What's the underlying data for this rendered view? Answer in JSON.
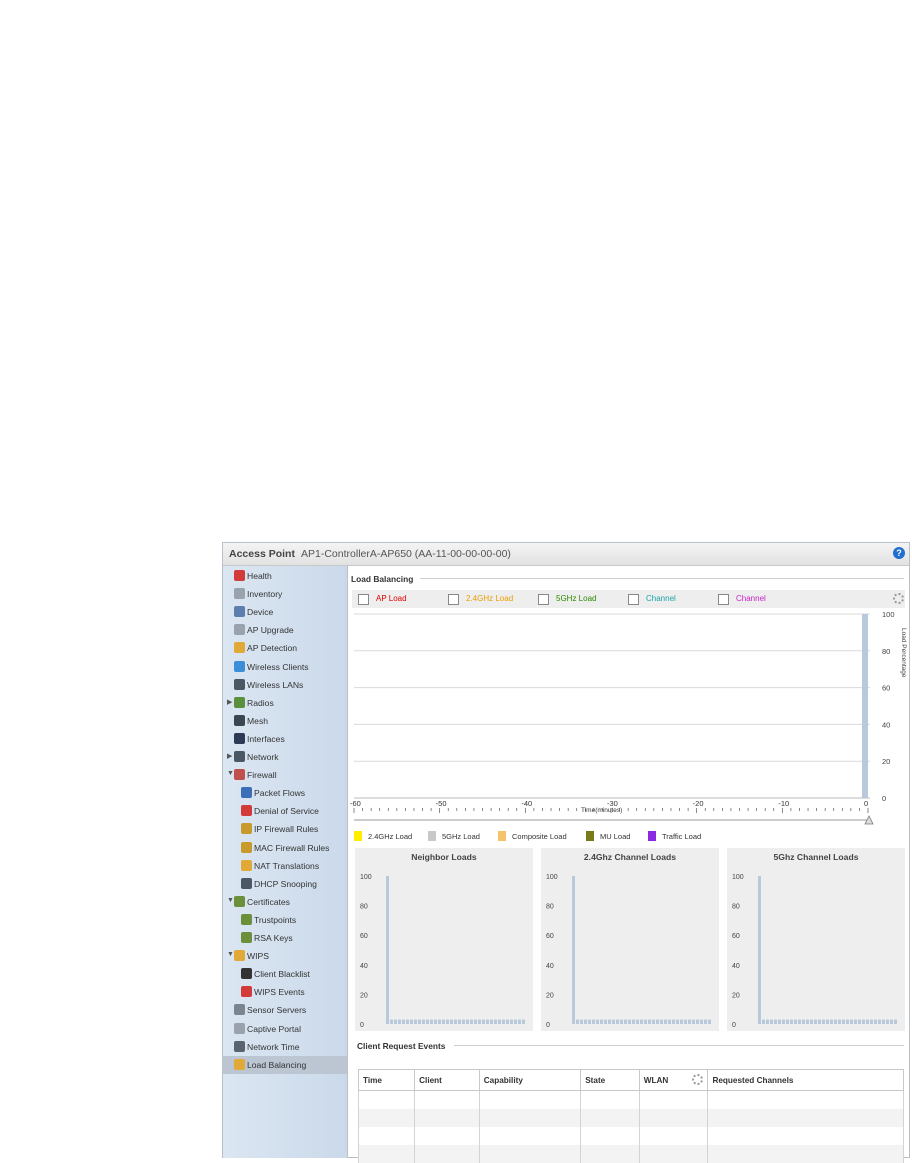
{
  "header": {
    "title": "Access Point",
    "device": "AP1-ControllerA-AP650 (AA-11-00-00-00-00)",
    "help_label": "?"
  },
  "sidebar": {
    "items": [
      {
        "label": "Health",
        "icon": "health-icon",
        "color": "#d33b3b",
        "indent": 0
      },
      {
        "label": "Inventory",
        "icon": "inventory-icon",
        "color": "#9aa3ad",
        "indent": 0
      },
      {
        "label": "Device",
        "icon": "device-icon",
        "color": "#5d7fb0",
        "indent": 0
      },
      {
        "label": "AP Upgrade",
        "icon": "ap-upgrade-icon",
        "color": "#9aa3ad",
        "indent": 0
      },
      {
        "label": "AP Detection",
        "icon": "ap-detection-icon",
        "color": "#e0a938",
        "indent": 0
      },
      {
        "label": "Wireless Clients",
        "icon": "wireless-clients-icon",
        "color": "#3d8ed8",
        "indent": 0
      },
      {
        "label": "Wireless LANs",
        "icon": "wireless-lans-icon",
        "color": "#4a5866",
        "indent": 0
      },
      {
        "label": "Radios",
        "icon": "radios-icon",
        "color": "#5a8f3d",
        "indent": 0,
        "arrow": "▶"
      },
      {
        "label": "Mesh",
        "icon": "mesh-icon",
        "color": "#3a4652",
        "indent": 0
      },
      {
        "label": "Interfaces",
        "icon": "interfaces-icon",
        "color": "#2d3a55",
        "indent": 0
      },
      {
        "label": "Network",
        "icon": "network-icon",
        "color": "#4a5866",
        "indent": 0,
        "arrow": "▶"
      },
      {
        "label": "Firewall",
        "icon": "firewall-icon",
        "color": "#c0504d",
        "indent": 0,
        "arrow": "▼"
      },
      {
        "label": "Packet Flows",
        "icon": "packet-flows-icon",
        "color": "#3d6fb8",
        "indent": 1
      },
      {
        "label": "Denial of Service",
        "icon": "denial-of-service-icon",
        "color": "#d33b3b",
        "indent": 1
      },
      {
        "label": "IP Firewall Rules",
        "icon": "ip-firewall-rules-icon",
        "color": "#c79a2b",
        "indent": 1
      },
      {
        "label": "MAC Firewall Rules",
        "icon": "mac-firewall-rules-icon",
        "color": "#c79a2b",
        "indent": 1
      },
      {
        "label": "NAT Translations",
        "icon": "nat-translations-icon",
        "color": "#e0a938",
        "indent": 1
      },
      {
        "label": "DHCP Snooping",
        "icon": "dhcp-snooping-icon",
        "color": "#4a5866",
        "indent": 1
      },
      {
        "label": "Certificates",
        "icon": "certificates-icon",
        "color": "#6b8f3a",
        "indent": 0,
        "arrow": "▼"
      },
      {
        "label": "Trustpoints",
        "icon": "trustpoints-icon",
        "color": "#6b8f3a",
        "indent": 1
      },
      {
        "label": "RSA Keys",
        "icon": "rsa-keys-icon",
        "color": "#6b8f3a",
        "indent": 1
      },
      {
        "label": "WIPS",
        "icon": "wips-icon",
        "color": "#e0a938",
        "indent": 0,
        "arrow": "▼"
      },
      {
        "label": "Client Blacklist",
        "icon": "client-blacklist-icon",
        "color": "#333333",
        "indent": 1
      },
      {
        "label": "WIPS Events",
        "icon": "wips-events-icon",
        "color": "#d33b3b",
        "indent": 1
      },
      {
        "label": "Sensor Servers",
        "icon": "sensor-servers-icon",
        "color": "#7a8590",
        "indent": 0
      },
      {
        "label": "Captive Portal",
        "icon": "captive-portal-icon",
        "color": "#9aa3ad",
        "indent": 0
      },
      {
        "label": "Network Time",
        "icon": "network-time-icon",
        "color": "#5a6470",
        "indent": 0
      },
      {
        "label": "Load Balancing",
        "icon": "load-balancing-icon",
        "color": "#e0a938",
        "indent": 0,
        "selected": true
      }
    ]
  },
  "load_balancing": {
    "section_label": "Load Balancing",
    "toggles": [
      {
        "label": "AP Load",
        "color": "#e00000"
      },
      {
        "label": "2.4GHz Load",
        "color": "#e8a000"
      },
      {
        "label": "5GHz Load",
        "color": "#2f8a00"
      },
      {
        "label": "Channel",
        "color": "#1aa6a6"
      },
      {
        "label": "Channel",
        "color": "#cc22cc"
      }
    ],
    "legend": [
      {
        "label": "2.4GHz Load",
        "color": "#ffee00"
      },
      {
        "label": "5GHz Load",
        "color": "#c8c8c8"
      },
      {
        "label": "Composite Load",
        "color": "#f5c36b"
      },
      {
        "label": "MU Load",
        "color": "#7a7a1a"
      },
      {
        "label": "Traffic Load",
        "color": "#8a2be2"
      }
    ]
  },
  "chart_data": [
    {
      "type": "bar",
      "title": "",
      "xlabel": "Time(minutes)",
      "ylabel": "Load Percentage",
      "x": [
        -60,
        -50,
        -40,
        -30,
        -20,
        -10,
        0
      ],
      "xlim": [
        -60,
        0
      ],
      "ylim": [
        0,
        100
      ],
      "yticks": [
        0,
        20,
        40,
        60,
        80,
        100
      ],
      "series": [
        {
          "values": [
            100
          ]
        }
      ],
      "grid": true
    },
    {
      "type": "bar",
      "title": "Neighbor Loads",
      "ylim": [
        0,
        100
      ],
      "yticks": [
        0,
        20,
        40,
        60,
        80,
        100
      ],
      "values": [
        100,
        3,
        3,
        3,
        3,
        3,
        3,
        3,
        3,
        3,
        3,
        3,
        3,
        3,
        3,
        3,
        3,
        3,
        3,
        3,
        3,
        3,
        3,
        3,
        3,
        3,
        3,
        3,
        3,
        3,
        3,
        3,
        3,
        3,
        3
      ]
    },
    {
      "type": "bar",
      "title": "2.4Ghz Channel Loads",
      "ylim": [
        0,
        100
      ],
      "yticks": [
        0,
        20,
        40,
        60,
        80,
        100
      ],
      "values": [
        100,
        3,
        3,
        3,
        3,
        3,
        3,
        3,
        3,
        3,
        3,
        3,
        3,
        3,
        3,
        3,
        3,
        3,
        3,
        3,
        3,
        3,
        3,
        3,
        3,
        3,
        3,
        3,
        3,
        3,
        3,
        3,
        3,
        3,
        3
      ]
    },
    {
      "type": "bar",
      "title": "5Ghz Channel Loads",
      "ylim": [
        0,
        100
      ],
      "yticks": [
        0,
        20,
        40,
        60,
        80,
        100
      ],
      "values": [
        100,
        3,
        3,
        3,
        3,
        3,
        3,
        3,
        3,
        3,
        3,
        3,
        3,
        3,
        3,
        3,
        3,
        3,
        3,
        3,
        3,
        3,
        3,
        3,
        3,
        3,
        3,
        3,
        3,
        3,
        3,
        3,
        3,
        3,
        3
      ]
    }
  ],
  "client_events": {
    "section_label": "Client Request Events",
    "columns": [
      "Time",
      "Client",
      "Capability",
      "State",
      "WLAN",
      "Requested Channels"
    ],
    "empty_rows": 4
  },
  "colors": {
    "bar": "#b8c9dc",
    "grid": "#d9d9d9"
  }
}
